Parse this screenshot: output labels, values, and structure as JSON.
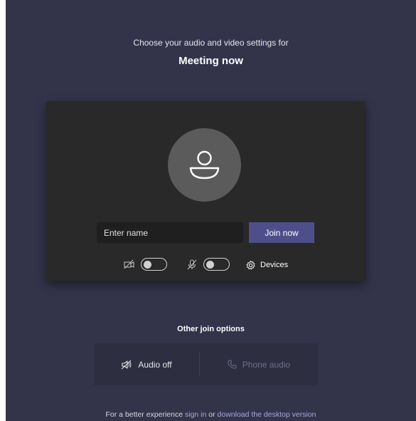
{
  "header": {
    "subtitle": "Choose your audio and video settings for",
    "meeting_title": "Meeting now"
  },
  "preview": {
    "avatar_icon": "person-icon",
    "name_placeholder": "Enter name",
    "name_value": "",
    "join_label": "Join now",
    "camera_icon": "camera-off-icon",
    "camera_on": false,
    "mic_icon": "mic-off-icon",
    "mic_on": false,
    "devices_icon": "gear-icon",
    "devices_label": "Devices"
  },
  "join_options": {
    "title": "Other join options",
    "audio_off_label": "Audio off",
    "audio_off_icon": "speaker-off-icon",
    "phone_audio_label": "Phone audio",
    "phone_audio_icon": "phone-icon"
  },
  "footer": {
    "prefix": "For a better experience ",
    "sign_in": "sign in",
    "middle": " or ",
    "download": "download the desktop version"
  },
  "colors": {
    "background": "#33344a",
    "preview_bg": "#292929",
    "accent": "#4e4f8a",
    "link": "#a6a7dc"
  }
}
